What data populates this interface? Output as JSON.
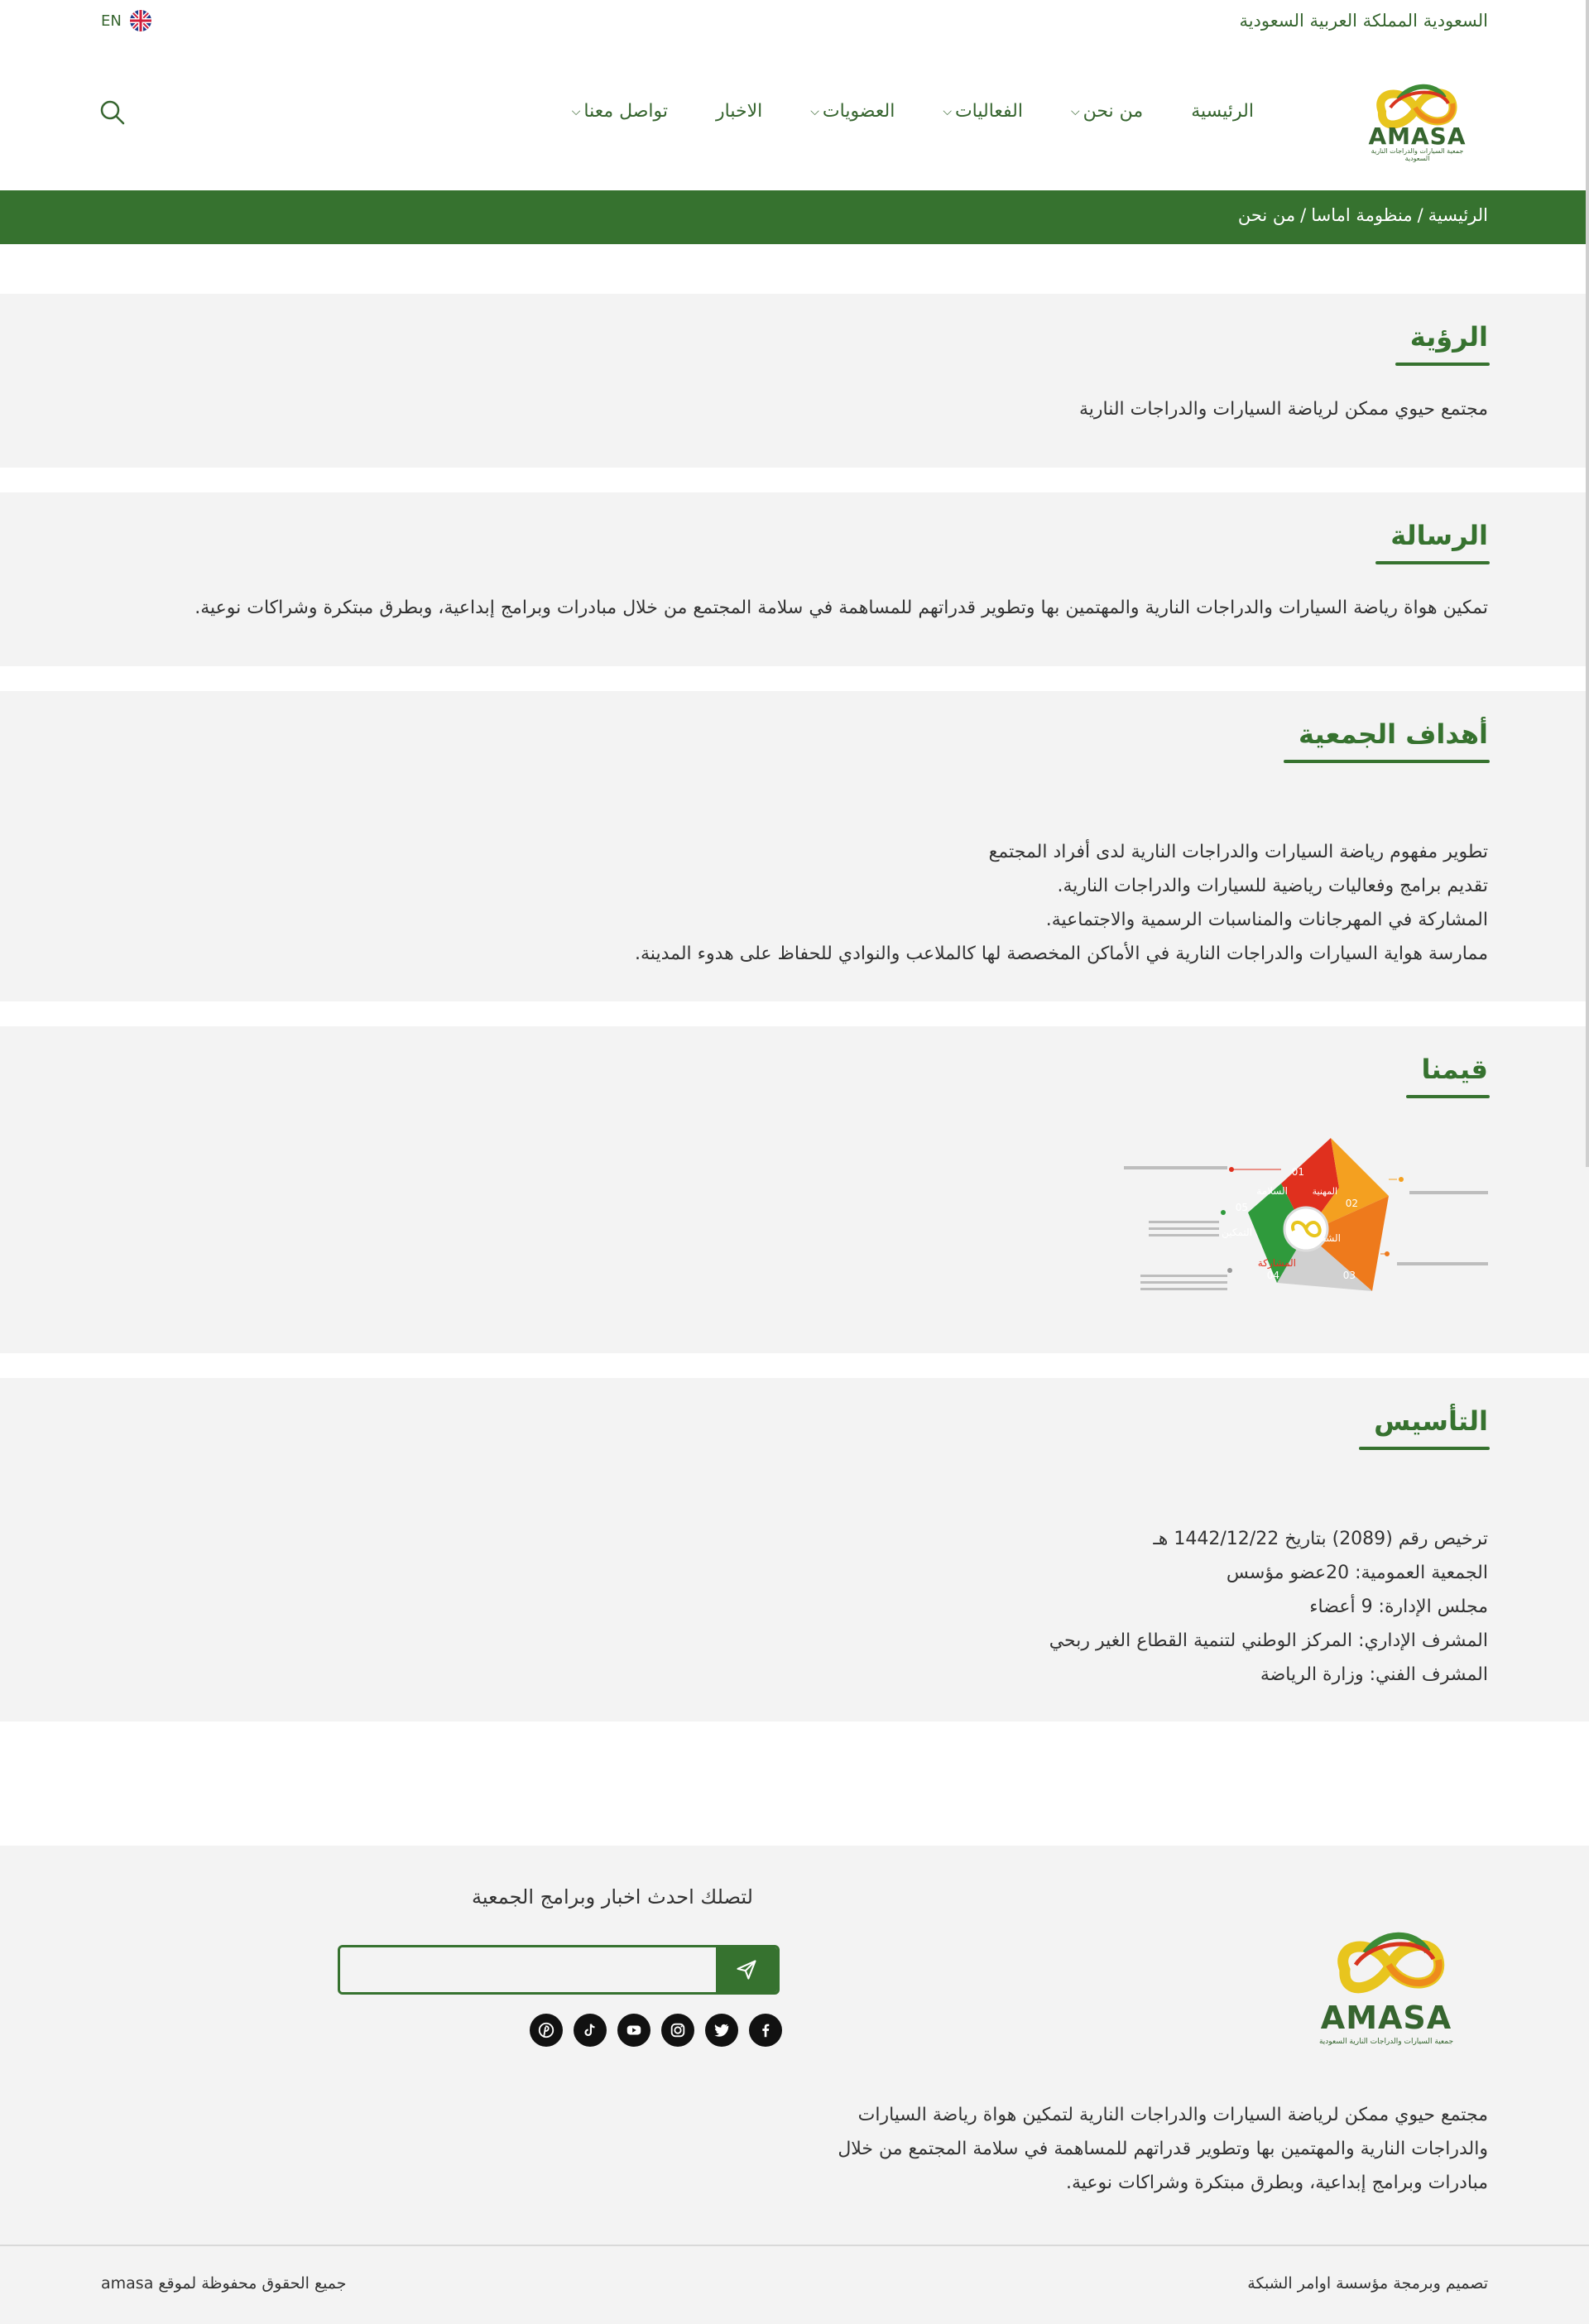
{
  "topbar": {
    "country_label": "السعودية المملكة العربية السعودية",
    "lang_label": "EN"
  },
  "header": {
    "logo_text": "AMASA",
    "logo_subtitle": "جمعية السيارات والدراجات النارية السعودية",
    "nav": [
      {
        "label": "الرئيسية",
        "has_dropdown": false
      },
      {
        "label": "من نحن",
        "has_dropdown": true
      },
      {
        "label": "الفعاليات",
        "has_dropdown": true
      },
      {
        "label": "العضويات",
        "has_dropdown": true
      },
      {
        "label": "الاخبار",
        "has_dropdown": false
      },
      {
        "label": "تواصل معنا",
        "has_dropdown": true
      }
    ]
  },
  "breadcrumb": [
    "الرئيسية",
    "منظومة اماسا",
    "من نحن"
  ],
  "sections": {
    "vision": {
      "title": "الرؤية",
      "text": "مجتمع حيوي ممكن لرياضة السيارات والدراجات النارية"
    },
    "mission": {
      "title": "الرسالة",
      "text": "تمكين هواة رياضة السيارات والدراجات النارية والمهتمين بها وتطوير قدراتهم للمساهمة في سلامة المجتمع من خلال مبادرات وبرامج إبداعية، وبطرق مبتكرة وشراكات نوعية."
    },
    "goals": {
      "title": "أهداف الجمعية",
      "items": [
        "تطوير مفهوم رياضة السيارات والدراجات النارية لدى أفراد المجتمع",
        "تقديم برامج وفعاليات رياضية للسيارات والدراجات النارية.",
        "المشاركة في المهرجانات والمناسبات الرسمية والاجتماعية.",
        "ممارسة هواية السيارات والدراجات النارية في الأماكن المخصصة لها كالملاعب والنوادي للحفاظ على هدوء المدينة."
      ]
    },
    "values": {
      "title": "قيمنا",
      "diagram": {
        "items": [
          {
            "num": "01",
            "label": "السلامة",
            "color": "#e0301e"
          },
          {
            "num": "02",
            "label": "المهنية",
            "color": "#f4a020"
          },
          {
            "num": "03",
            "label": "الشغف",
            "color": "#ee7a1c"
          },
          {
            "num": "04",
            "label": "المشاركة",
            "color": "#c8c8c8"
          },
          {
            "num": "05",
            "label": "التمكين",
            "color": "#2f9a3c"
          }
        ]
      }
    },
    "founding": {
      "title": "التأسيس",
      "items": [
        "ترخيص رقم (2089) بتاريخ 1442/12/22 هـ",
        "الجمعية العمومية: 20عضو مؤسس",
        "مجلس الإدارة: 9 أعضاء",
        "المشرف الإداري: المركز الوطني لتنمية القطاع الغير ربحي",
        "المشرف الفني: وزارة الرياضة"
      ]
    }
  },
  "footer": {
    "logo_text": "AMASA",
    "logo_subtitle": "جمعية السيارات والدراجات النارية السعودية",
    "newsletter_title": "لتصلك احدث اخبار وبرامج الجمعية",
    "newsletter_placeholder": "",
    "socials": [
      "pinterest-icon",
      "tiktok-icon",
      "youtube-icon",
      "instagram-icon",
      "twitter-icon",
      "facebook-icon"
    ],
    "description": "مجتمع حيوي ممكن لرياضة السيارات والدراجات النارية لتمكين هواة رياضة السيارات والدراجات النارية والمهتمين بها وتطوير قدراتهم للمساهمة في سلامة المجتمع من خلال مبادرات وبرامج إبداعية، وبطرق مبتكرة وشراكات نوعية.",
    "credits": "تصميم وبرمجة مؤسسة اوامر الشبكة",
    "copyright": "جميع الحقوق محفوظة لموقع amasa"
  },
  "colors": {
    "primary_green": "#36722f",
    "section_bg": "#f3f3f3"
  }
}
